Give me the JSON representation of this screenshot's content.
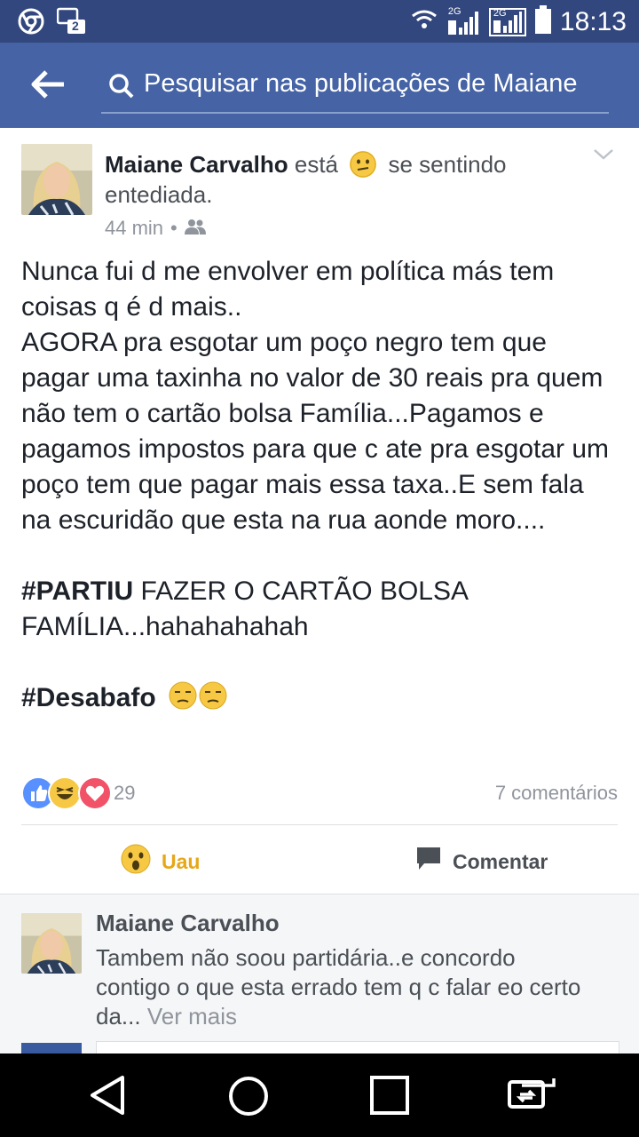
{
  "status_bar": {
    "time": "18:13",
    "network_label_1": "2G",
    "network_label_2": "2G",
    "sim_badge": "2"
  },
  "search": {
    "text": "Pesquisar nas publicações de Maiane"
  },
  "post": {
    "author": "Maiane Carvalho",
    "feeling_prefix": "está",
    "feeling_text": "se sentindo entediada.",
    "time": "44 min",
    "separator": "•",
    "paragraphs": [
      "Nunca fui d me envolver em política más tem coisas q é d mais..",
      "AGORA pra esgotar um poço negro tem que pagar uma taxinha no valor de 30 reais pra quem não tem o cartão bolsa Família...Pagamos e pagamos impostos para que c ate pra esgotar um poço tem que pagar mais essa taxa..E sem fala na escuridão que esta na rua aonde moro...."
    ],
    "hashtag1_tag": "#PARTIU",
    "hashtag1_rest": " FAZER O CARTÃO BOLSA FAMÍLIA...hahahahahah",
    "hashtag2_tag": "#Desabafo",
    "reaction_count": "29",
    "comments_count": "7 comentários",
    "actions": {
      "uau": "Uau",
      "comment": "Comentar"
    }
  },
  "comment": {
    "author": "Maiane Carvalho",
    "text": "Tambem não soou partidária..e concordo contigo o que esta errado tem q c falar eo certo da...",
    "see_more": "Ver mais"
  },
  "colors": {
    "status_bar": "#32477d",
    "app_bar": "#4563a5",
    "uau": "#e6a817",
    "like": "#5890ff",
    "love": "#f25268"
  }
}
